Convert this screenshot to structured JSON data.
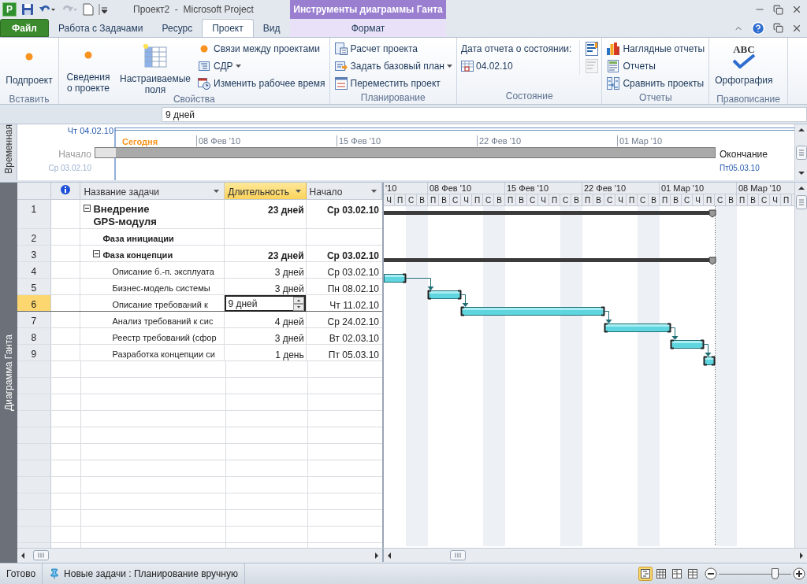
{
  "title_bar": {
    "app_letter": "P",
    "title": "Проект2  -  Microsoft Project",
    "context_title": "Инструменты диаграммы Ганта"
  },
  "tabs": [
    {
      "label": "Файл",
      "kind": "file",
      "selected": false
    },
    {
      "label": "Работа с Задачами",
      "kind": "normal",
      "selected": false
    },
    {
      "label": "Ресурс",
      "kind": "normal",
      "selected": false
    },
    {
      "label": "Проект",
      "kind": "normal",
      "selected": true
    },
    {
      "label": "Вид",
      "kind": "normal",
      "selected": false
    },
    {
      "label": "Формат",
      "kind": "context",
      "selected": false
    }
  ],
  "ribbon_groups": [
    {
      "label": "Вставить",
      "items": [
        {
          "kind": "large",
          "label": "Подпроект"
        }
      ]
    },
    {
      "label": "Свойства",
      "items": [
        {
          "kind": "large",
          "label": "Сведения о проекте"
        },
        {
          "kind": "large",
          "label": "Настраиваемые поля"
        },
        {
          "kind": "small",
          "label": "Связи между проектами",
          "dropdown": false
        },
        {
          "kind": "small",
          "label": "СДР",
          "dropdown": true
        },
        {
          "kind": "small",
          "label": "Изменить рабочее время",
          "dropdown": false
        }
      ]
    },
    {
      "label": "Планирование",
      "items": [
        {
          "kind": "small",
          "label": "Расчет проекта",
          "dropdown": false
        },
        {
          "kind": "small",
          "label": "Задать базовый план",
          "dropdown": true
        },
        {
          "kind": "small",
          "label": "Переместить проект",
          "dropdown": false
        }
      ]
    },
    {
      "label": "Состояние",
      "items": [
        {
          "kind": "text",
          "label": "Дата отчета о состоянии:"
        },
        {
          "kind": "date",
          "label": "04.02.10"
        },
        {
          "kind": "icon",
          "disabled": false
        },
        {
          "kind": "icon",
          "disabled": true
        }
      ]
    },
    {
      "label": "Отчеты",
      "items": [
        {
          "kind": "small",
          "label": "Наглядные отчеты",
          "dropdown": false
        },
        {
          "kind": "small",
          "label": "Отчеты",
          "dropdown": false
        },
        {
          "kind": "small",
          "label": "Сравнить проекты",
          "dropdown": false
        }
      ]
    },
    {
      "label": "Правописание",
      "items": [
        {
          "kind": "large",
          "label": "Орфография",
          "icon_text": "ABC"
        }
      ]
    }
  ],
  "entry_bar": {
    "value": "9 дней"
  },
  "timeline": {
    "side_label": "Временная",
    "current_date": "Чт 04.02.10",
    "today_label": "Сегодня",
    "ticks": [
      "08 Фев '10",
      "15 Фев '10",
      "22 Фев '10",
      "01 Мар '10"
    ],
    "start_label": "Начало",
    "start_date": "Ср 03.02.10",
    "finish_label": "Окончание",
    "finish_date": "Пт05.03.10"
  },
  "view_label": "Диаграмма Ганта",
  "table": {
    "columns": [
      {
        "kind": "indicators",
        "selected": false
      },
      {
        "kind": "text",
        "label": "Название задачи",
        "selected": false
      },
      {
        "kind": "text",
        "label": "Длительность",
        "selected": true
      },
      {
        "kind": "text",
        "label": "Начало",
        "selected": false
      }
    ],
    "tasks": [
      {
        "id": "1",
        "name": "Внедрение GPS-модуля",
        "duration": "23 дней",
        "start": "Ср 03.02.10",
        "kind": "summary",
        "selected": false,
        "editing": false,
        "expanded": true,
        "children": [
          {
            "id": "2",
            "name": "Фаза инициации",
            "kind": "summary",
            "selected": false,
            "editing": false
          },
          {
            "id": "3",
            "name": "Фаза концепции",
            "duration": "23 дней",
            "start": "Ср 03.02.10",
            "kind": "summary",
            "selected": false,
            "editing": false,
            "expanded": true,
            "children": [
              {
                "id": "4",
                "name": "Описание б.-п. эксплуата",
                "duration": "3 дней",
                "start": "Ср 03.02.10",
                "kind": "task",
                "selected": false,
                "editing": false
              },
              {
                "id": "5",
                "name": "Бизнес-модель системы",
                "duration": "3 дней",
                "start": "Пн 08.02.10",
                "kind": "task",
                "selected": false,
                "editing": false
              },
              {
                "id": "6",
                "name": "Описание требований к",
                "duration": "9 дней",
                "start": "Чт 11.02.10",
                "kind": "task",
                "selected": true,
                "editing": true
              },
              {
                "id": "7",
                "name": "Анализ требований к сис",
                "duration": "4 дней",
                "start": "Ср 24.02.10",
                "kind": "task",
                "selected": false,
                "editing": false
              },
              {
                "id": "8",
                "name": "Реестр требований (сфор",
                "duration": "3 дней",
                "start": "Вт 02.03.10",
                "kind": "task",
                "selected": false,
                "editing": false
              },
              {
                "id": "9",
                "name": "Разработка концепции си",
                "duration": "1 день",
                "start": "Пт 05.03.10",
                "kind": "task",
                "selected": false,
                "editing": false
              }
            ]
          }
        ]
      }
    ]
  },
  "gantt": {
    "weeks": [
      "'10",
      "08 Фев '10",
      "15 Фев '10",
      "22 Фев '10",
      "01 Мар '10",
      "08 Мар '10"
    ],
    "days": [
      "Ч",
      "П",
      "С",
      "В",
      "П",
      "В",
      "С",
      "Ч",
      "П",
      "С",
      "В",
      "П",
      "В",
      "С",
      "Ч",
      "П",
      "С",
      "В",
      "П",
      "В",
      "С",
      "Ч",
      "П",
      "С",
      "В",
      "П",
      "В",
      "С",
      "Ч",
      "П",
      "С",
      "В",
      "П",
      "В",
      "С",
      "Ч",
      "П"
    ]
  },
  "status_bar": {
    "ready": "Готово",
    "task_mode": "Новые задачи : Планирование вручную",
    "views": [
      {
        "selected": true
      },
      {
        "selected": false
      },
      {
        "selected": false
      },
      {
        "selected": false
      }
    ],
    "zoom": {
      "level": 0.77
    }
  }
}
